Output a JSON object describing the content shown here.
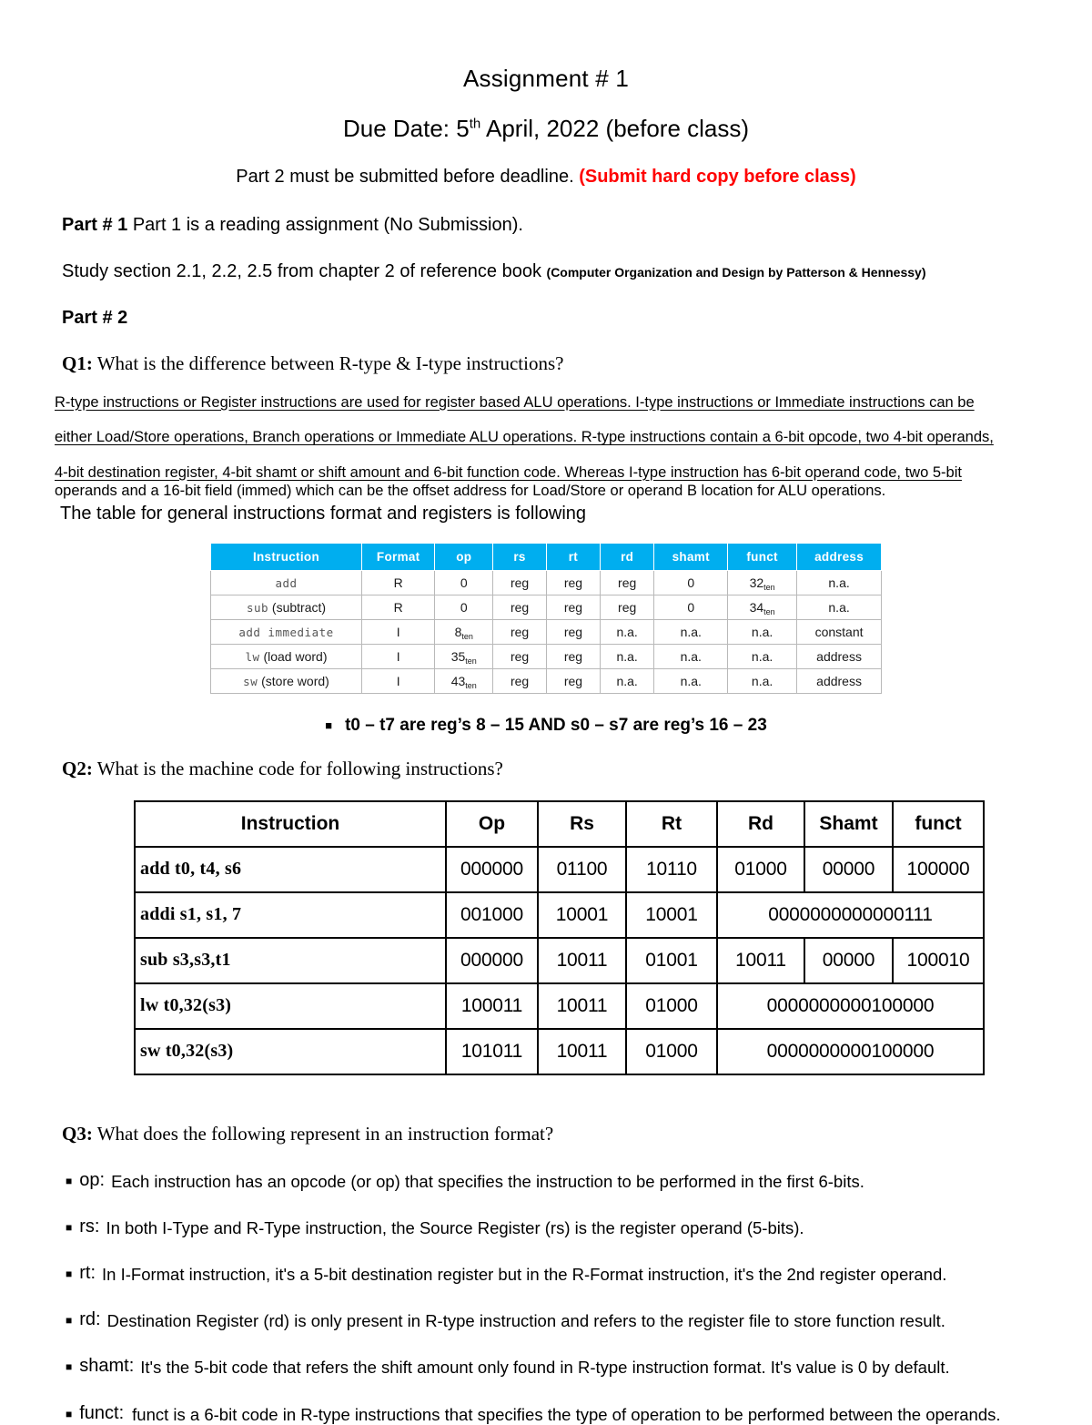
{
  "header": {
    "title": "Assignment # 1",
    "due_prefix": "Due Date: 5",
    "due_sup": "th",
    "due_suffix": " April, 2022 (before class)",
    "notice_black": "Part 2 must be submitted before deadline. ",
    "notice_red": "(Submit hard copy before class)"
  },
  "part1": {
    "label": "Part # 1",
    "text": " Part 1 is a reading assignment (No Submission).",
    "study_text": "Study section 2.1, 2.2, 2.5 from chapter 2 of reference book ",
    "study_ref": "(Computer Organization and Design by Patterson & Hennessy)"
  },
  "part2": {
    "label": "Part # 2"
  },
  "q1": {
    "label": "Q1:",
    "text": " What is the difference between R-type & I-type instructions?",
    "answer_lines": [
      "R-type instructions or Register instructions are used for register based ALU operations. I-type instructions or Immediate instructions can be",
      "either Load/Store operations, Branch operations or Immediate ALU operations. R-type instructions contain a 6-bit opcode, two 4-bit operands,",
      "4-bit destination register, 4-bit shamt or shift amount and 6-bit function code. Whereas I-type instruction has 6-bit operand code, two 5-bit",
      "operands and a 16-bit field (immed) which can be the offset address for Load/Store or operand B location for ALU operations."
    ],
    "answer_tail": "The table for general instructions format and registers is following"
  },
  "format_table": {
    "headers": [
      "Instruction",
      "Format",
      "op",
      "rs",
      "rt",
      "rd",
      "shamt",
      "funct",
      "address"
    ],
    "rows": [
      {
        "instruction_code": "add",
        "instruction_plain": "",
        "format": "R",
        "op": "0",
        "op_sub": "",
        "rs": "reg",
        "rt": "reg",
        "rd": "reg",
        "shamt": "0",
        "funct": "32",
        "funct_sub": "ten",
        "address": "n.a."
      },
      {
        "instruction_code": "sub",
        "instruction_plain": " (subtract)",
        "format": "R",
        "op": "0",
        "op_sub": "",
        "rs": "reg",
        "rt": "reg",
        "rd": "reg",
        "shamt": "0",
        "funct": "34",
        "funct_sub": "ten",
        "address": "n.a."
      },
      {
        "instruction_code": "add immediate",
        "instruction_plain": "",
        "format": "I",
        "op": "8",
        "op_sub": "ten",
        "rs": "reg",
        "rt": "reg",
        "rd": "n.a.",
        "shamt": "n.a.",
        "funct": "n.a.",
        "funct_sub": "",
        "address": "constant"
      },
      {
        "instruction_code": "lw",
        "instruction_plain": " (load word)",
        "format": "I",
        "op": "35",
        "op_sub": "ten",
        "rs": "reg",
        "rt": "reg",
        "rd": "n.a.",
        "shamt": "n.a.",
        "funct": "n.a.",
        "funct_sub": "",
        "address": "address"
      },
      {
        "instruction_code": "sw",
        "instruction_plain": " (store word)",
        "format": "I",
        "op": "43",
        "op_sub": "ten",
        "rs": "reg",
        "rt": "reg",
        "rd": "n.a.",
        "shamt": "n.a.",
        "funct": "n.a.",
        "funct_sub": "",
        "address": "address"
      }
    ]
  },
  "register_note": {
    "bullet": "■",
    "text": "t0 – t7 are reg’s 8 – 15 AND s0 – s7 are reg’s 16 – 23"
  },
  "q2": {
    "label": "Q2:",
    "text": " What is the machine code for following instructions?",
    "headers": [
      "Instruction",
      "Op",
      "Rs",
      "Rt",
      "Rd",
      "Shamt",
      "funct"
    ],
    "rows": [
      {
        "instruction": "add  t0, t4, s6",
        "op": "000000",
        "rs": "01100",
        "rt": "10110",
        "rd": "01000",
        "shamt": "00000",
        "funct": "100000",
        "immediate": null
      },
      {
        "instruction": "addi s1, s1, 7",
        "op": "001000",
        "rs": "10001",
        "rt": "10001",
        "rd": null,
        "shamt": null,
        "funct": null,
        "immediate": "0000000000000111"
      },
      {
        "instruction": "sub s3,s3,t1",
        "op": "000000",
        "rs": "10011",
        "rt": "01001",
        "rd": "10011",
        "shamt": "00000",
        "funct": "100010",
        "immediate": null
      },
      {
        "instruction": "lw  t0,32(s3)",
        "op": "100011",
        "rs": "10011",
        "rt": "01000",
        "rd": null,
        "shamt": null,
        "funct": null,
        "immediate": "0000000000100000"
      },
      {
        "instruction": "sw  t0,32(s3)",
        "op": "101011",
        "rs": "10011",
        "rt": "01000",
        "rd": null,
        "shamt": null,
        "funct": null,
        "immediate": "0000000000100000"
      }
    ]
  },
  "q3": {
    "label": "Q3:",
    "text": " What does the following represent in an instruction format?",
    "bullet": "■",
    "items": [
      {
        "term": "op:",
        "desc": "Each instruction has an opcode (or op) that specifies the instruction to be performed in the first 6-bits."
      },
      {
        "term": "rs:",
        "desc": "In both I-Type and R-Type instruction, the Source Register (rs) is the register operand (5-bits)."
      },
      {
        "term": "rt:",
        "desc": "In I-Format instruction, it's a 5-bit destination register but in the R-Format instruction, it's the 2nd register operand."
      },
      {
        "term": "rd:",
        "desc": "Destination Register (rd) is only present in R-type instruction and refers to the register file to store function result."
      },
      {
        "term": "shamt:",
        "desc": "It's the 5-bit code that refers the shift amount only found in R-type instruction format. It's value is 0 by default."
      },
      {
        "term": "funct:",
        "desc": "funct is a 6-bit code in R-type instructions that specifies the type of operation to be performed between the operands."
      }
    ]
  },
  "colors": {
    "accent_blue": "#00aeef",
    "alert_red": "#ff0000",
    "text": "#000000"
  }
}
